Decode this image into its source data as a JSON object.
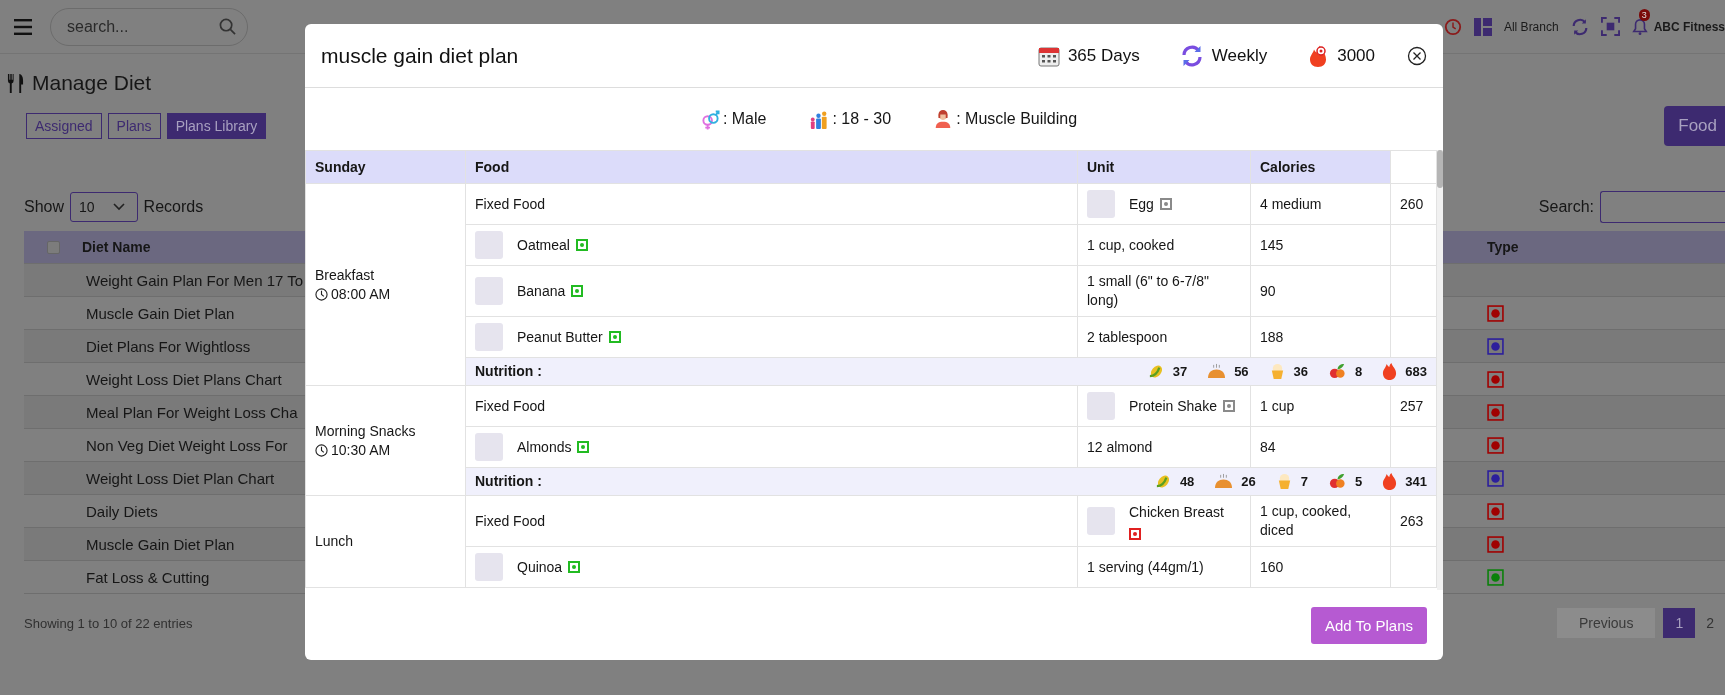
{
  "top_bar": {
    "search": {
      "placeholder": "search..."
    },
    "branch": "All Branch",
    "notifications": "3",
    "gym": "ABC Fitness"
  },
  "page": {
    "title": "Manage Diet",
    "tabs": [
      {
        "label": "Assigned",
        "selected": false
      },
      {
        "label": "Plans",
        "selected": false
      },
      {
        "label": "Plans Library",
        "selected": true
      }
    ],
    "food_button": "Food",
    "show_label": "Show",
    "page_size": "10",
    "records_label": "Records",
    "search_label": "Search:",
    "table": {
      "columns": [
        "Diet Name",
        "Type"
      ],
      "select_all": {
        "checked": false
      },
      "rows": [
        {
          "name": "Weight Gain Plan For Men 17 To"
        },
        {
          "name": "Muscle Gain Diet Plan",
          "color": "#a00000"
        },
        {
          "name": "Diet Plans For Wightloss",
          "color": "#2c1f9c"
        },
        {
          "name": "Weight Loss Diet Plans Chart",
          "color": "#a00000"
        },
        {
          "name": "Meal Plan For Weight Loss Cha",
          "color": "#a00000"
        },
        {
          "name": "Non Veg Diet Weight Loss For",
          "color": "#a00000"
        },
        {
          "name": "Weight Loss Diet Plan Chart",
          "color": "#2c1f9c"
        },
        {
          "name": "Daily Diets",
          "color": "#a00000"
        },
        {
          "name": "Muscle Gain Diet Plan",
          "color": "#a00000"
        },
        {
          "name": "Fat Loss & Cutting",
          "color": "#0a800a"
        }
      ]
    },
    "info": "Showing 1 to 10 of 22 entries",
    "pagination": [
      {
        "label": "Previous",
        "selected": false,
        "disabled": true
      },
      {
        "label": "1",
        "selected": true,
        "disabled": false
      },
      {
        "label": "2",
        "selected": false,
        "disabled": false
      }
    ]
  },
  "modal": {
    "title": "muscle gain diet plan",
    "duration": "365 Days",
    "frequency": "Weekly",
    "calories": "3000",
    "gender": ": Male",
    "age": ": 18 - 30",
    "goal": ": Muscle Building",
    "columns": [
      "Sunday",
      "Food",
      "Unit",
      "Calories"
    ],
    "meals": [
      {
        "name": "Breakfast",
        "time": "08:00 AM",
        "items": [
          {
            "kind": "fixed",
            "label": "Fixed Food",
            "food": "Egg",
            "color": "#8a8a8a",
            "unit": "4 medium",
            "calories": "260"
          },
          {
            "kind": "food",
            "food": "Oatmeal",
            "color": "#22bb22",
            "unit": "1 cup, cooked",
            "calories": "145"
          },
          {
            "kind": "food",
            "food": "Banana",
            "color": "#22bb22",
            "unit": "1 small (6\" to 6-7/8\" long)",
            "calories": "90"
          },
          {
            "kind": "food",
            "food": "Peanut Butter",
            "color": "#22bb22",
            "unit": "2 tablespoon",
            "calories": "188"
          }
        ],
        "nutrition": {
          "label": "Nutrition :",
          "values": [
            {
              "kind": "carbs",
              "value": "37"
            },
            {
              "kind": "protein",
              "value": "56"
            },
            {
              "kind": "fat",
              "value": "36"
            },
            {
              "kind": "fiber",
              "value": "8"
            },
            {
              "kind": "calories",
              "value": "683"
            }
          ]
        }
      },
      {
        "name": "Morning Snacks",
        "time": "10:30 AM",
        "items": [
          {
            "kind": "fixed",
            "label": "Fixed Food",
            "food": "Protein Shake",
            "color": "#8a8a8a",
            "unit": "1 cup",
            "calories": "257"
          },
          {
            "kind": "food",
            "food": "Almonds",
            "color": "#22bb22",
            "unit": "12 almond",
            "calories": "84"
          }
        ],
        "nutrition": {
          "label": "Nutrition :",
          "values": [
            {
              "kind": "carbs",
              "value": "48"
            },
            {
              "kind": "protein",
              "value": "26"
            },
            {
              "kind": "fat",
              "value": "7"
            },
            {
              "kind": "fiber",
              "value": "5"
            },
            {
              "kind": "calories",
              "value": "341"
            }
          ]
        }
      },
      {
        "name": "Lunch",
        "items": [
          {
            "kind": "fixed",
            "label": "Fixed Food",
            "food": "Chicken Breast",
            "color": "#e02020",
            "unit": "1 cup, cooked, diced",
            "calories": "263"
          },
          {
            "kind": "food",
            "food": "Quinoa",
            "color": "#22bb22",
            "unit": "1 serving (44gm/1)",
            "calories": "160"
          }
        ]
      }
    ],
    "add_button": "Add To Plans"
  }
}
